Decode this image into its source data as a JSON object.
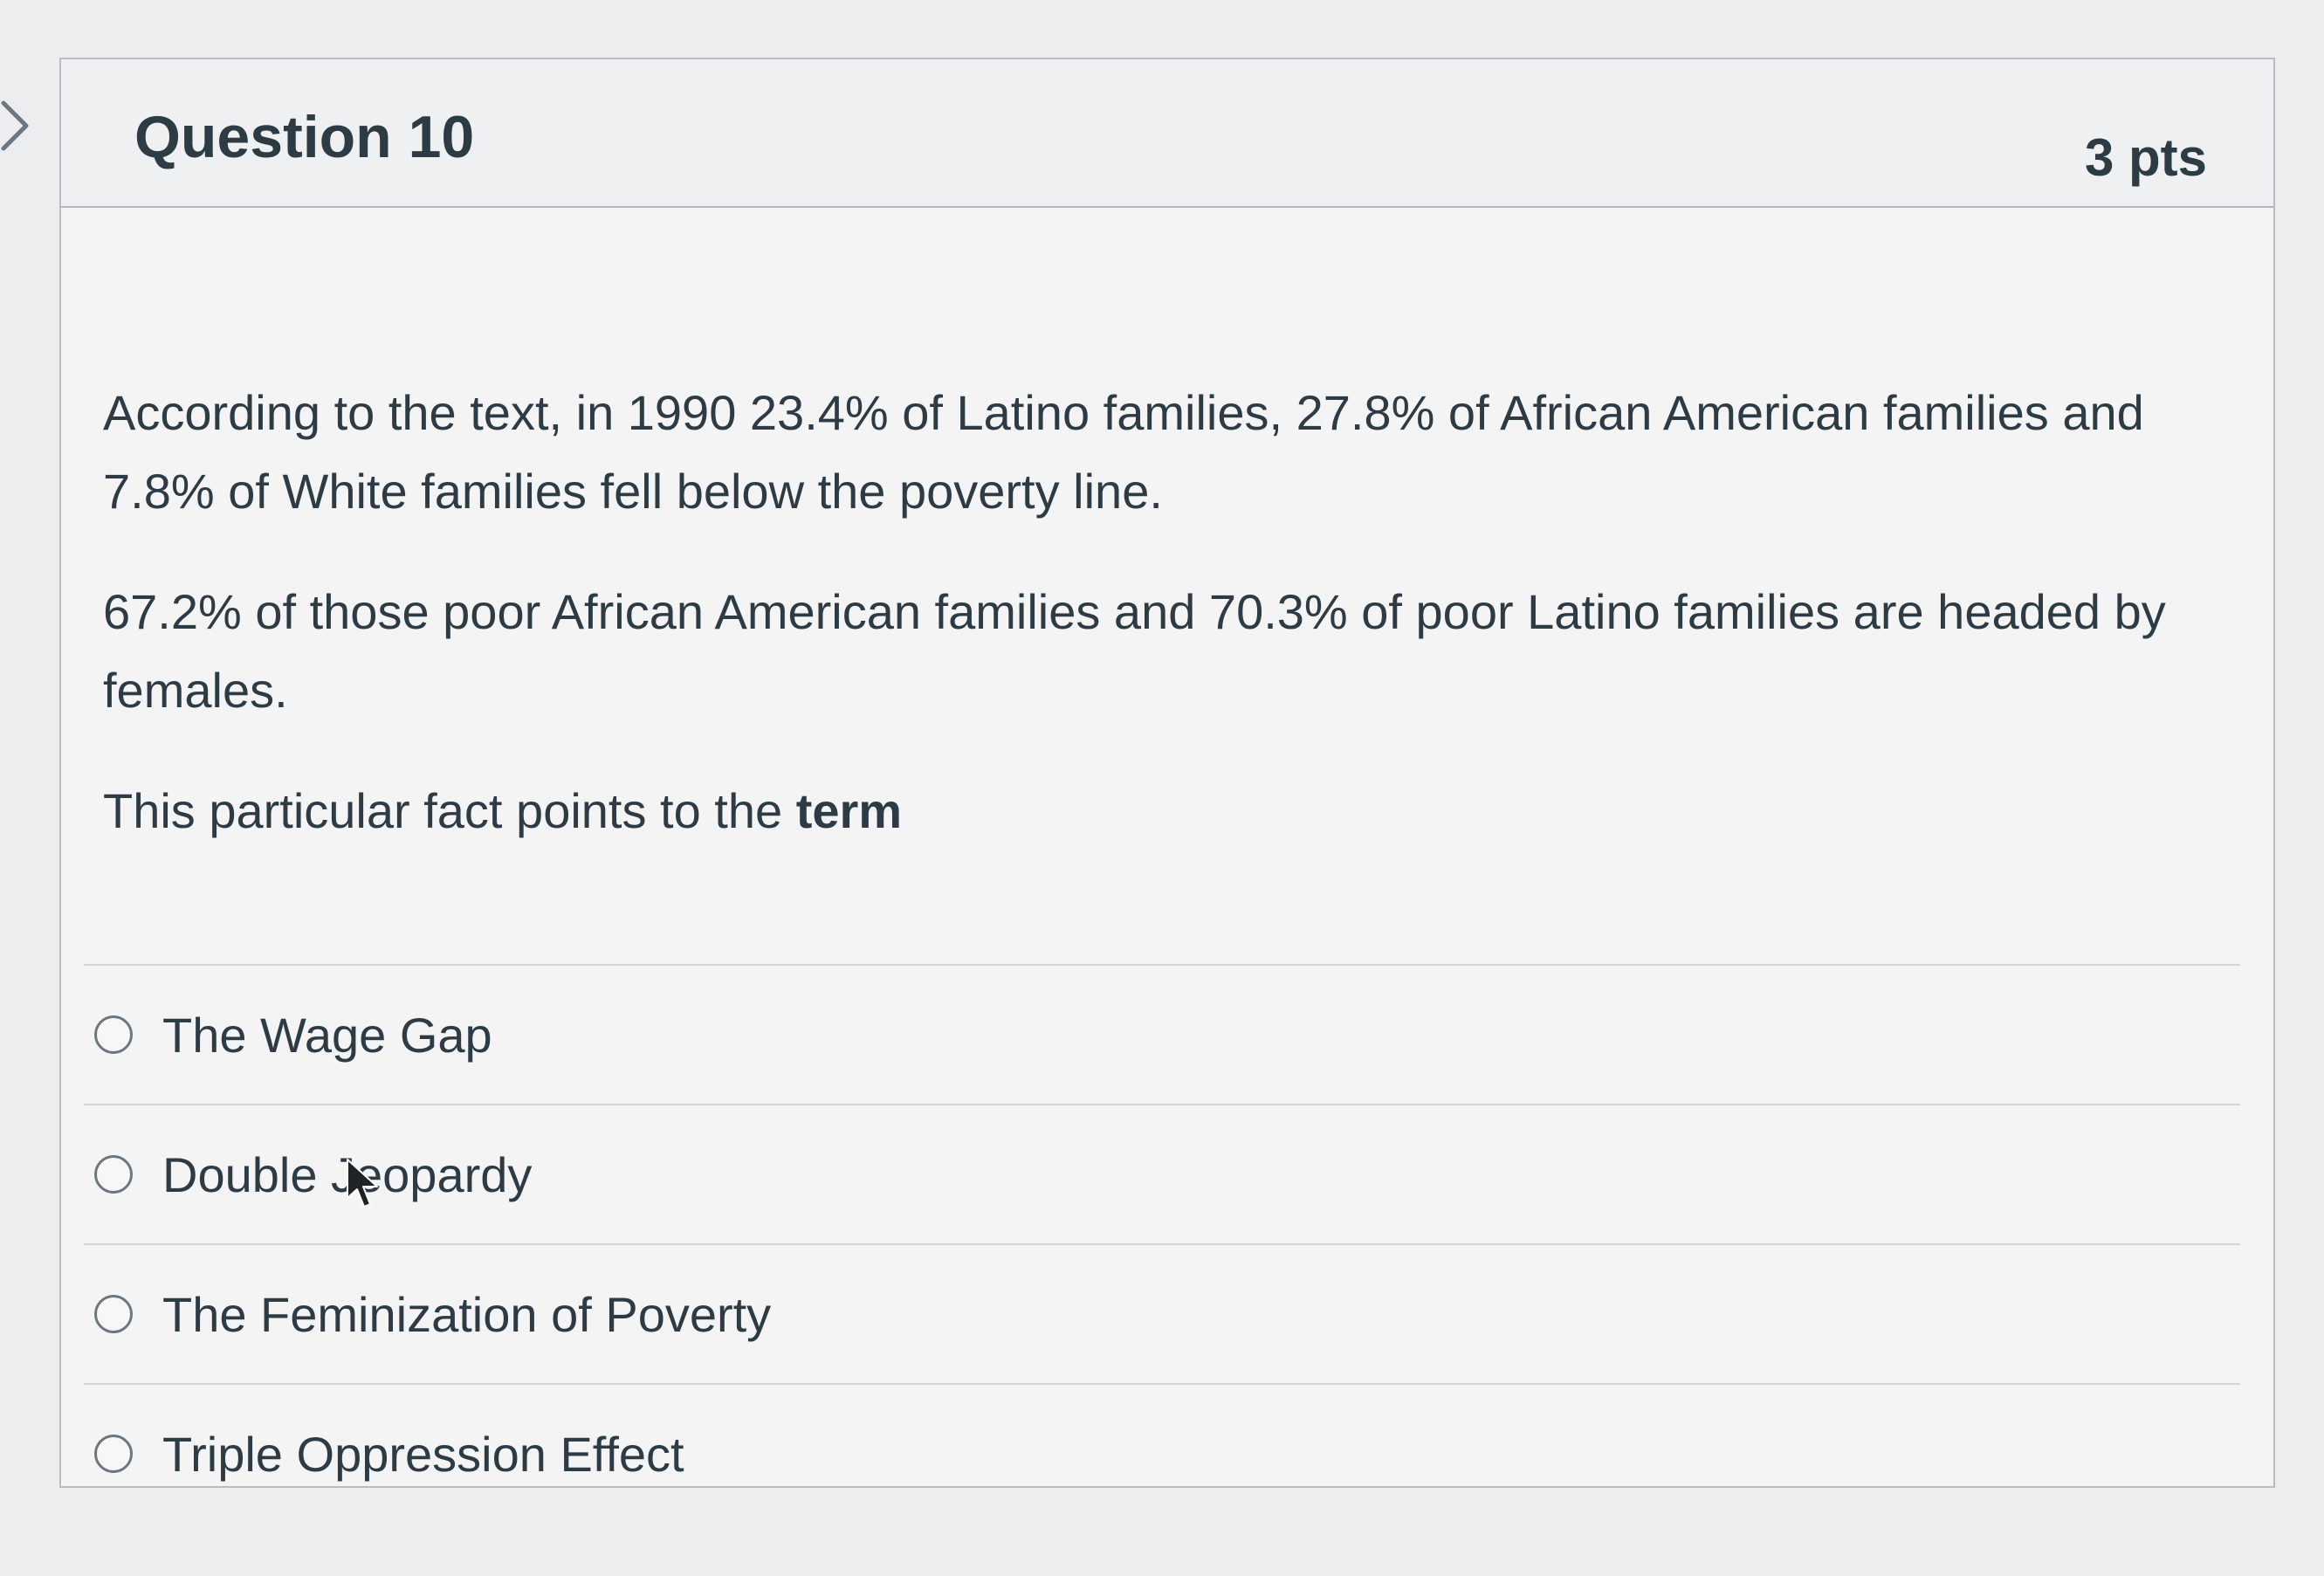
{
  "question": {
    "title": "Question 10",
    "points": "3 pts",
    "paragraph1": "According to the text, in 1990 23.4% of Latino families, 27.8% of African American families and 7.8% of White families fell below the poverty line.",
    "paragraph2": "67.2% of those poor African American families and 70.3% of poor Latino families are headed by females.",
    "paragraph3_prefix": "This particular fact points to the ",
    "paragraph3_bold": "term"
  },
  "answers": [
    {
      "label": "The Wage Gap",
      "selected": false
    },
    {
      "label": "Double Jeopardy",
      "selected": false
    },
    {
      "label": "The Feminization of Poverty",
      "selected": false
    },
    {
      "label": "Triple Oppression Effect",
      "selected": false
    }
  ],
  "icons": {
    "collapse": "chevron-right-icon",
    "radio": "radio-unchecked-icon",
    "cursor": "mouse-pointer-icon"
  },
  "colors": {
    "text": "#2d3b45",
    "border": "#b9bdc1",
    "radio_border": "#6b7780"
  }
}
